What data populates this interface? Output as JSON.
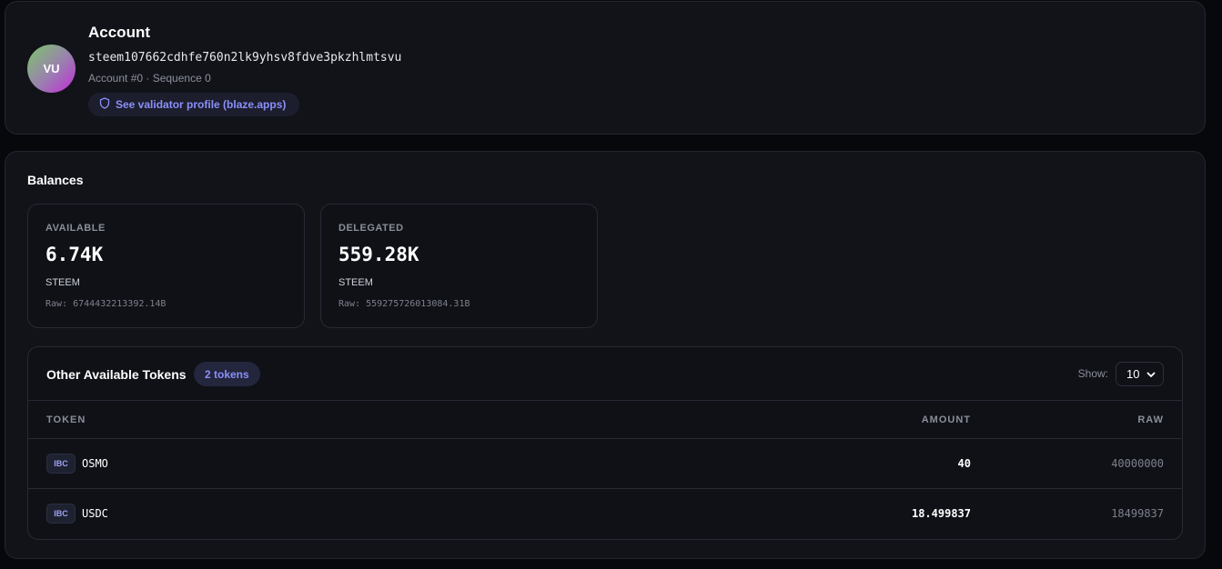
{
  "account": {
    "title": "Account",
    "avatar_initials": "VU",
    "address": "steem107662cdhfe760n2lk9yhsv8fdve3pkzhlmtsvu",
    "meta": "Account #0 · Sequence 0",
    "validator_link": "See validator profile (blaze.apps)"
  },
  "balances": {
    "title": "Balances",
    "available": {
      "label": "AVAILABLE",
      "value": "6.74K",
      "unit": "STEEM",
      "raw": "Raw: 6744432213392.14B"
    },
    "delegated": {
      "label": "DELEGATED",
      "value": "559.28K",
      "unit": "STEEM",
      "raw": "Raw: 559275726013084.31B"
    }
  },
  "tokens": {
    "title": "Other Available Tokens",
    "badge": "2 tokens",
    "show_label": "Show:",
    "show_value": "10",
    "columns": {
      "token": "TOKEN",
      "amount": "AMOUNT",
      "raw": "RAW"
    },
    "rows": [
      {
        "badge": "IBC",
        "name": "OSMO",
        "amount": "40",
        "raw": "40000000"
      },
      {
        "badge": "IBC",
        "name": "USDC",
        "amount": "18.499837",
        "raw": "18499837"
      }
    ]
  },
  "colors": {
    "accent": "#8b8ff8",
    "card_bg": "#111319",
    "page_bg": "#07080b"
  },
  "icons": {
    "validator": "shield-icon",
    "select": "chevron-down-icon"
  }
}
